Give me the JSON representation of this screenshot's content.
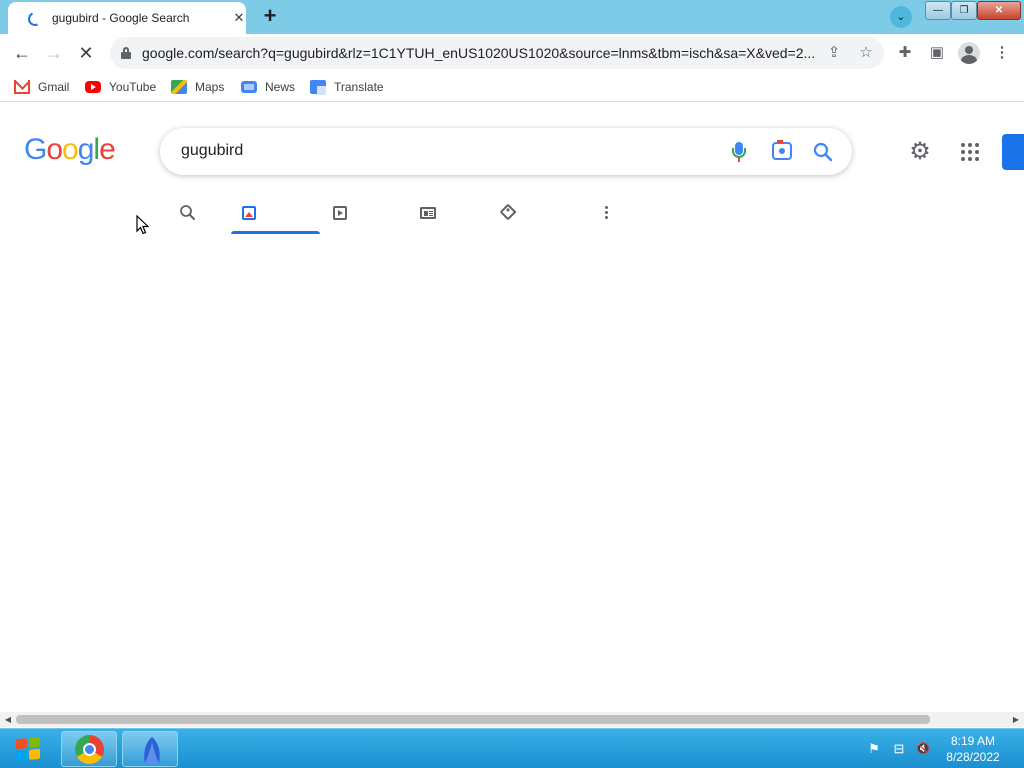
{
  "browser": {
    "tab": {
      "title": "gugubird - Google Search",
      "close_glyph": "✕"
    },
    "new_tab_glyph": "+",
    "tab_search_glyph": "⌄",
    "window": {
      "minimize_glyph": "—",
      "maximize_glyph": "❐",
      "close_glyph": "✕"
    },
    "toolbar": {
      "back_glyph": "←",
      "forward_glyph": "→",
      "stop_glyph": "✕",
      "url": "google.com/search?q=gugubird&rlz=1C1YTUH_enUS1020US1020&source=lnms&tbm=isch&sa=X&ved=2...",
      "share_glyph": "⇪",
      "bookmark_star_glyph": "☆",
      "extensions_glyph": "✚",
      "side_panel_glyph": "▣",
      "menu_glyph": "⋮"
    },
    "bookmarks": [
      {
        "label": "Gmail",
        "icon": "gmail-icon"
      },
      {
        "label": "YouTube",
        "icon": "youtube-icon"
      },
      {
        "label": "Maps",
        "icon": "maps-icon"
      },
      {
        "label": "News",
        "icon": "news-icon"
      },
      {
        "label": "Translate",
        "icon": "translate-icon"
      }
    ]
  },
  "google": {
    "logo": [
      "G",
      "o",
      "o",
      "g",
      "l",
      "e"
    ],
    "logo_colors": [
      "#4285f4",
      "#ea4335",
      "#fbbc05",
      "#4285f4",
      "#34a853",
      "#ea4335"
    ],
    "search_query": "gugubird",
    "settings_glyph": "⚙",
    "tabs": [
      {
        "name": "all",
        "icon": "search-icon",
        "active": false
      },
      {
        "name": "images",
        "icon": "image-icon",
        "active": true
      },
      {
        "name": "videos",
        "icon": "video-icon",
        "active": false
      },
      {
        "name": "news",
        "icon": "newspaper-icon",
        "active": false
      },
      {
        "name": "shopping",
        "icon": "tag-icon",
        "active": false
      },
      {
        "name": "more",
        "icon": "more-vert-icon",
        "active": false
      }
    ],
    "accent_color": "#1a73e8"
  },
  "scrollbar": {
    "left_arrow": "◀",
    "right_arrow": "▶"
  },
  "taskbar": {
    "apps": [
      "chrome-icon",
      "bird-app-icon"
    ],
    "tray": {
      "flag_glyph": "⚑",
      "network_glyph": "⊟",
      "volume_glyph": "🔇"
    },
    "clock": {
      "time": "8:19 AM",
      "date": "8/28/2022"
    }
  }
}
